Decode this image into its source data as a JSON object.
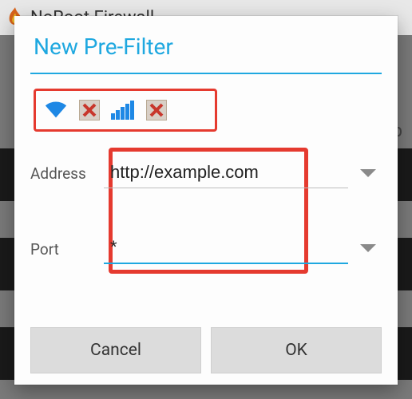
{
  "background": {
    "app_title": "NoRoot Firewall",
    "help_label": "elp"
  },
  "dialog": {
    "title": "New Pre-Filter",
    "address_label": "Address",
    "address_value": "http://example.com",
    "port_label": "Port",
    "port_value": "*",
    "cancel_label": "Cancel",
    "ok_label": "OK"
  },
  "icons": {
    "wifi": "wifi-icon",
    "wifi_block": "cross-icon",
    "cellular": "cellular-bars-icon",
    "cellular_block": "cross-icon",
    "dropdown": "chevron-down-icon"
  },
  "colors": {
    "accent": "#1fa8e0",
    "highlight": "#e53a2f"
  }
}
